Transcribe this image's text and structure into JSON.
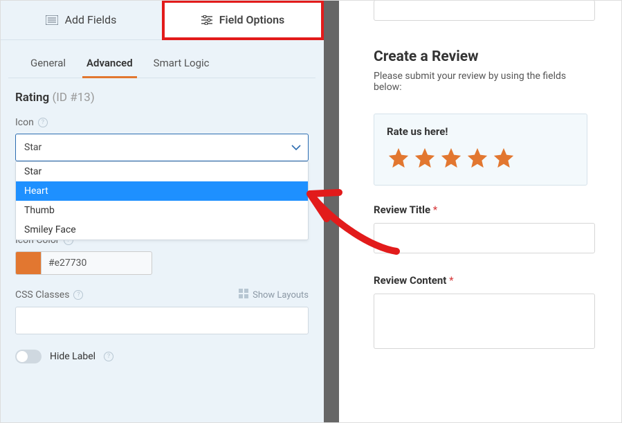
{
  "top_tabs": {
    "add_fields": "Add Fields",
    "field_options": "Field Options"
  },
  "sub_tabs": {
    "general": "General",
    "advanced": "Advanced",
    "smart_logic": "Smart Logic"
  },
  "field_heading": {
    "name": "Rating",
    "id_label": "(ID #13)"
  },
  "icon_section": {
    "label": "Icon",
    "selected": "Star",
    "options": [
      "Star",
      "Heart",
      "Thumb",
      "Smiley Face"
    ],
    "highlighted_option": "Heart"
  },
  "icon_color": {
    "label": "Icon Color",
    "value": "#e27730"
  },
  "css_classes": {
    "label": "CSS Classes",
    "show_layouts": "Show Layouts"
  },
  "hide_label": {
    "label": "Hide Label"
  },
  "preview": {
    "title": "Create a Review",
    "subtitle": "Please submit your review by using the fields below:",
    "rate_label": "Rate us here!",
    "star_count": 5,
    "review_title_label": "Review Title",
    "review_content_label": "Review Content",
    "required_marker": "*"
  },
  "colors": {
    "star": "#e27730",
    "highlight_red": "#e21b1b"
  }
}
